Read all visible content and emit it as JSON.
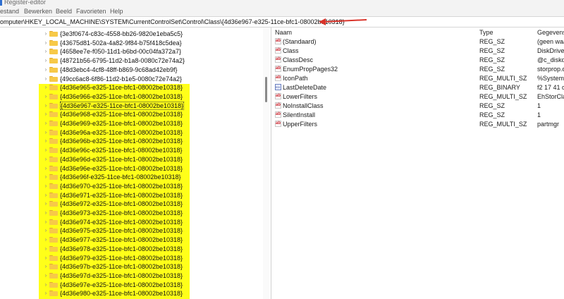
{
  "window": {
    "title": "Register-editor"
  },
  "menu": [
    "estand",
    "Bewerken",
    "Beeld",
    "Favorieten",
    "Help"
  ],
  "address": "omputer\\HKEY_LOCAL_MACHINE\\SYSTEM\\CurrentControlSet\\Control\\Class\\{4d36e967-e325-11ce-bfc1-08002be10318}",
  "annotation": {
    "arrow_color": "#d9342b",
    "highlight_color": "#ffff19"
  },
  "tree": {
    "items": [
      "{3e3f0674-c83c-4558-bb26-9820e1eba5c5}",
      "{43675d81-502a-4a82-9f84-b75f418c5dea}",
      "{4658ee7e-f050-11d1-b6bd-00c04fa372a7}",
      "{48721b56-6795-11d2-b1a8-0080c72e74a2}",
      "{48d3ebc4-4cf8-48ff-b869-9c68ad42eb9f}",
      "{49cc6ac8-6f86-11d2-b1e5-0080c72e74a2}",
      "{4d36e965-e325-11ce-bfc1-08002be10318}",
      "{4d36e966-e325-11ce-bfc1-08002be10318}",
      "{4d36e967-e325-11ce-bfc1-08002be10318}",
      "{4d36e968-e325-11ce-bfc1-08002be10318}",
      "{4d36e969-e325-11ce-bfc1-08002be10318}",
      "{4d36e96a-e325-11ce-bfc1-08002be10318}",
      "{4d36e96b-e325-11ce-bfc1-08002be10318}",
      "{4d36e96c-e325-11ce-bfc1-08002be10318}",
      "{4d36e96d-e325-11ce-bfc1-08002be10318}",
      "{4d36e96e-e325-11ce-bfc1-08002be10318}",
      "{4d36e96f-e325-11ce-bfc1-08002be10318}",
      "{4d36e970-e325-11ce-bfc1-08002be10318}",
      "{4d36e971-e325-11ce-bfc1-08002be10318}",
      "{4d36e972-e325-11ce-bfc1-08002be10318}",
      "{4d36e973-e325-11ce-bfc1-08002be10318}",
      "{4d36e974-e325-11ce-bfc1-08002be10318}",
      "{4d36e975-e325-11ce-bfc1-08002be10318}",
      "{4d36e977-e325-11ce-bfc1-08002be10318}",
      "{4d36e978-e325-11ce-bfc1-08002be10318}",
      "{4d36e979-e325-11ce-bfc1-08002be10318}",
      "{4d36e97b-e325-11ce-bfc1-08002be10318}",
      "{4d36e97d-e325-11ce-bfc1-08002be10318}",
      "{4d36e97e-e325-11ce-bfc1-08002be10318}",
      "{4d36e980-e325-11ce-bfc1-08002be10318}"
    ],
    "selected": "{4d36e967-e325-11ce-bfc1-08002be10318}"
  },
  "values": {
    "columns": {
      "name": "Naam",
      "type": "Type",
      "data": "Gegevens"
    },
    "rows": [
      {
        "icon": "string-value-icon",
        "name": "(Standaard)",
        "type": "REG_SZ",
        "data": "(geen waar"
      },
      {
        "icon": "string-value-icon",
        "name": "Class",
        "type": "REG_SZ",
        "data": "DiskDrive"
      },
      {
        "icon": "string-value-icon",
        "name": "ClassDesc",
        "type": "REG_SZ",
        "data": "@c_diskdri"
      },
      {
        "icon": "string-value-icon",
        "name": "EnumPropPages32",
        "type": "REG_SZ",
        "data": "storprop.d"
      },
      {
        "icon": "string-value-icon",
        "name": "IconPath",
        "type": "REG_MULTI_SZ",
        "data": "%SystemR"
      },
      {
        "icon": "binary-value-icon",
        "name": "LastDeleteDate",
        "type": "REG_BINARY",
        "data": "f2 17 41 d"
      },
      {
        "icon": "string-value-icon",
        "name": "LowerFilters",
        "type": "REG_MULTI_SZ",
        "data": "EhStorClas"
      },
      {
        "icon": "string-value-icon",
        "name": "NoInstallClass",
        "type": "REG_SZ",
        "data": "1"
      },
      {
        "icon": "string-value-icon",
        "name": "SilentInstall",
        "type": "REG_SZ",
        "data": "1"
      },
      {
        "icon": "string-value-icon",
        "name": "UpperFilters",
        "type": "REG_MULTI_SZ",
        "data": "partmgr"
      }
    ]
  }
}
